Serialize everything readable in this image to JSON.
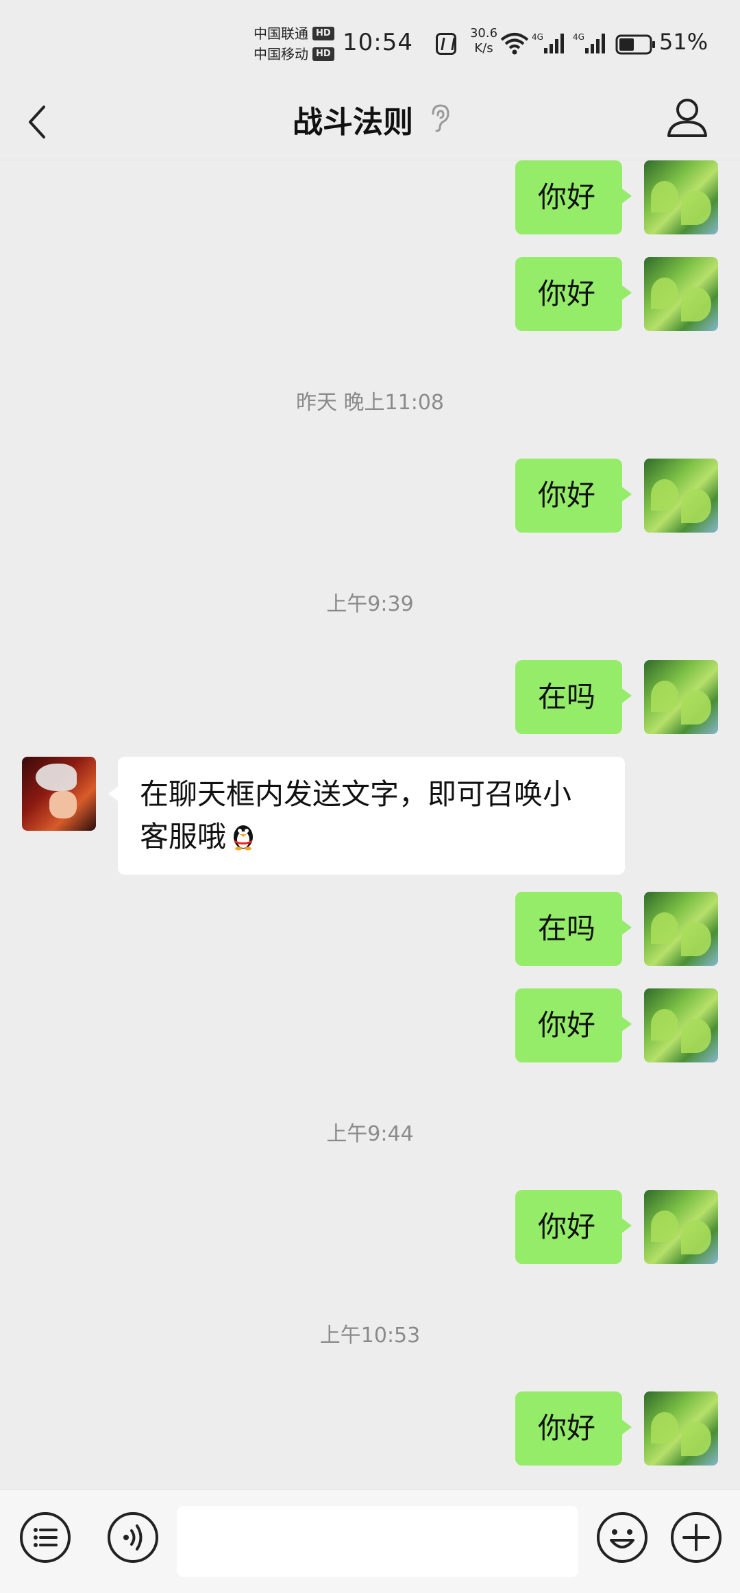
{
  "status_bar": {
    "carrier_1": "中国联通",
    "carrier_2": "中国移动",
    "hd_badge": "HD",
    "time": "10:54",
    "net_speed_value": "30.6",
    "net_speed_unit": "K/s",
    "network_type": "4G",
    "battery_percent": "51%",
    "battery_level": 0.51
  },
  "header": {
    "title": "战斗法则"
  },
  "messages": [
    {
      "type": "out",
      "text": "你好"
    },
    {
      "type": "out",
      "text": "你好"
    },
    {
      "type": "time",
      "text": "昨天 晚上11:08"
    },
    {
      "type": "out",
      "text": "你好"
    },
    {
      "type": "time",
      "text": "上午9:39"
    },
    {
      "type": "out",
      "text": "在吗"
    },
    {
      "type": "in",
      "line1": "在聊天框内发送文字，即可召唤小",
      "line2": "客服哦"
    },
    {
      "type": "out",
      "text": "在吗"
    },
    {
      "type": "out",
      "text": "你好"
    },
    {
      "type": "time",
      "text": "上午9:44"
    },
    {
      "type": "out",
      "text": "你好"
    },
    {
      "type": "time",
      "text": "上午10:53"
    },
    {
      "type": "out",
      "text": "你好"
    }
  ],
  "input": {
    "value": "",
    "placeholder": ""
  },
  "icons": {
    "back": "chevron-left-icon",
    "ear": "ear-icon",
    "profile": "person-icon",
    "menu": "list-menu-icon",
    "voice": "voice-icon",
    "emoji": "smiley-icon",
    "plus": "plus-icon"
  },
  "colors": {
    "background": "#ededed",
    "outgoing_bubble": "#95ec69",
    "incoming_bubble": "#ffffff",
    "timestamp": "#8a8a8a"
  }
}
